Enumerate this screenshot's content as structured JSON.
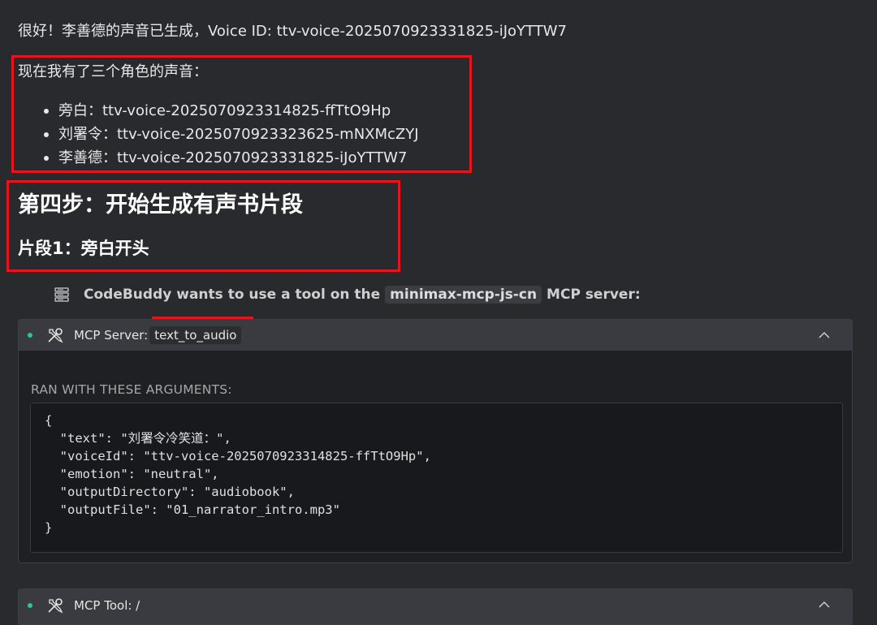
{
  "message": {
    "intro": "很好！李善德的声音已生成，Voice ID: ttv-voice-2025070923331825-iJoYTTW7",
    "voices_heading": "现在我有了三个角色的声音：",
    "voices": [
      {
        "text": "旁白：ttv-voice-2025070923314825-ffTtO9Hp"
      },
      {
        "text": "刘署令：ttv-voice-2025070923323625-mNXMcZYJ"
      },
      {
        "text": "李善德：ttv-voice-2025070923331825-iJoYTTW7"
      }
    ],
    "step_title": "第四步：开始生成有声书片段",
    "segment_title": "片段1：旁白开头"
  },
  "tool_request": {
    "icon": "server-icon",
    "prefix": "CodeBuddy wants to use a tool on the",
    "server_name": "minimax-mcp-js-cn",
    "suffix": "MCP server:"
  },
  "tool_panel": {
    "status_color": "#2fc58c",
    "icon": "tools-icon",
    "label": "MCP Server:",
    "tool_name": "text_to_audio",
    "chevron": "chevron-up-icon",
    "args_label": "RAN WITH THESE ARGUMENTS:",
    "code_lines": [
      "{",
      "  \"text\": \"刘署令冷笑道：\",",
      "  \"voiceId\": \"ttv-voice-2025070923314825-ffTtO9Hp\",",
      "  \"emotion\": \"neutral\",",
      "  \"outputDirectory\": \"audiobook\",",
      "  \"outputFile\": \"01_narrator_intro.mp3\"",
      "}"
    ]
  },
  "tool_panel_2": {
    "status_color": "#2fc58c",
    "icon": "tools-icon",
    "label": "MCP Tool: /",
    "chevron": "chevron-up-icon"
  },
  "colors": {
    "highlight": "#e8131c",
    "background": "#292a2e"
  }
}
